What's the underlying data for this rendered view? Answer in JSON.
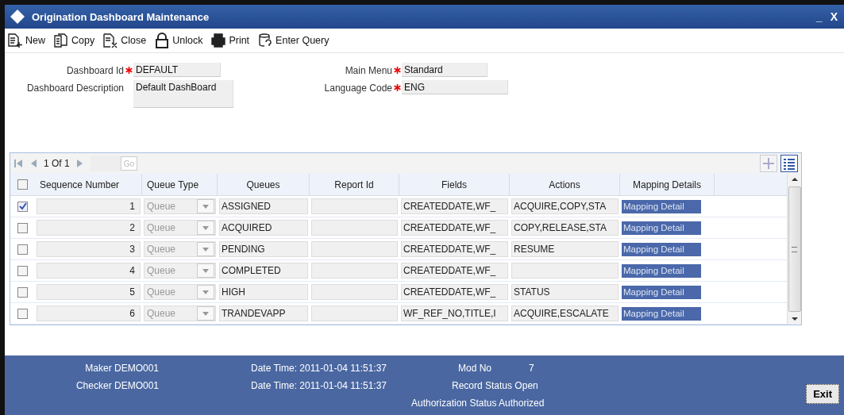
{
  "window": {
    "title": "Origination Dashboard Maintenance",
    "minimize": "_",
    "close": "X"
  },
  "toolbar": [
    {
      "label": "New",
      "kind": "new"
    },
    {
      "label": "Copy",
      "kind": "copy"
    },
    {
      "label": "Close",
      "kind": "close"
    },
    {
      "label": "Unlock",
      "kind": "unlock"
    },
    {
      "label": "Print",
      "kind": "print"
    },
    {
      "label": "Enter Query",
      "kind": "query"
    }
  ],
  "form": {
    "dashboard_id": {
      "label": "Dashboard Id",
      "required": true,
      "value": "DEFAULT"
    },
    "dashboard_description": {
      "label": "Dashboard Description",
      "required": false,
      "value": "Default DashBoard"
    },
    "main_menu": {
      "label": "Main Menu",
      "required": true,
      "value": "Standard"
    },
    "language_code": {
      "label": "Language Code",
      "required": true,
      "value": "ENG"
    }
  },
  "pager": {
    "text": "1 Of 1",
    "go": "Go"
  },
  "table": {
    "select_all_checked": false,
    "columns": [
      "Sequence Number",
      "Queue Type",
      "Queues",
      "Report Id",
      "Fields",
      "Actions",
      "Mapping Details"
    ],
    "rows": [
      {
        "checked": true,
        "sequence": "1",
        "queue_type": "Queue",
        "queue": "ASSIGNED",
        "report_id": "",
        "fields": "CREATEDDATE,WF_",
        "actions": "ACQUIRE,COPY,STA",
        "mapping": "Mapping Detail"
      },
      {
        "checked": false,
        "sequence": "2",
        "queue_type": "Queue",
        "queue": "ACQUIRED",
        "report_id": "",
        "fields": "CREATEDDATE,WF_",
        "actions": "COPY,RELEASE,STA",
        "mapping": "Mapping Detail"
      },
      {
        "checked": false,
        "sequence": "3",
        "queue_type": "Queue",
        "queue": "PENDING",
        "report_id": "",
        "fields": "CREATEDDATE,WF_",
        "actions": "RESUME",
        "mapping": "Mapping Detail"
      },
      {
        "checked": false,
        "sequence": "4",
        "queue_type": "Queue",
        "queue": "COMPLETED",
        "report_id": "",
        "fields": "CREATEDDATE,WF_",
        "actions": "",
        "mapping": "Mapping Detail"
      },
      {
        "checked": false,
        "sequence": "5",
        "queue_type": "Queue",
        "queue": "HIGH",
        "report_id": "",
        "fields": "CREATEDDATE,WF_",
        "actions": "STATUS",
        "mapping": "Mapping Detail"
      },
      {
        "checked": false,
        "sequence": "6",
        "queue_type": "Queue",
        "queue": "TRANDEVAPP",
        "report_id": "",
        "fields": "WF_REF_NO,TITLE,I",
        "actions": "ACQUIRE,ESCALATE",
        "mapping": "Mapping Detail"
      }
    ]
  },
  "footer": {
    "maker": "Maker DEMO001",
    "maker_time": "Date Time: 2011-01-04 11:51:37",
    "mod_no_label": "Mod No",
    "mod_no": "7",
    "checker": "Checker DEMO001",
    "checker_time": "Date Time: 2011-01-04 11:51:37",
    "record_status": "Record Status Open",
    "authorization_status": "Authorization Status Authorized",
    "exit": "Exit"
  }
}
